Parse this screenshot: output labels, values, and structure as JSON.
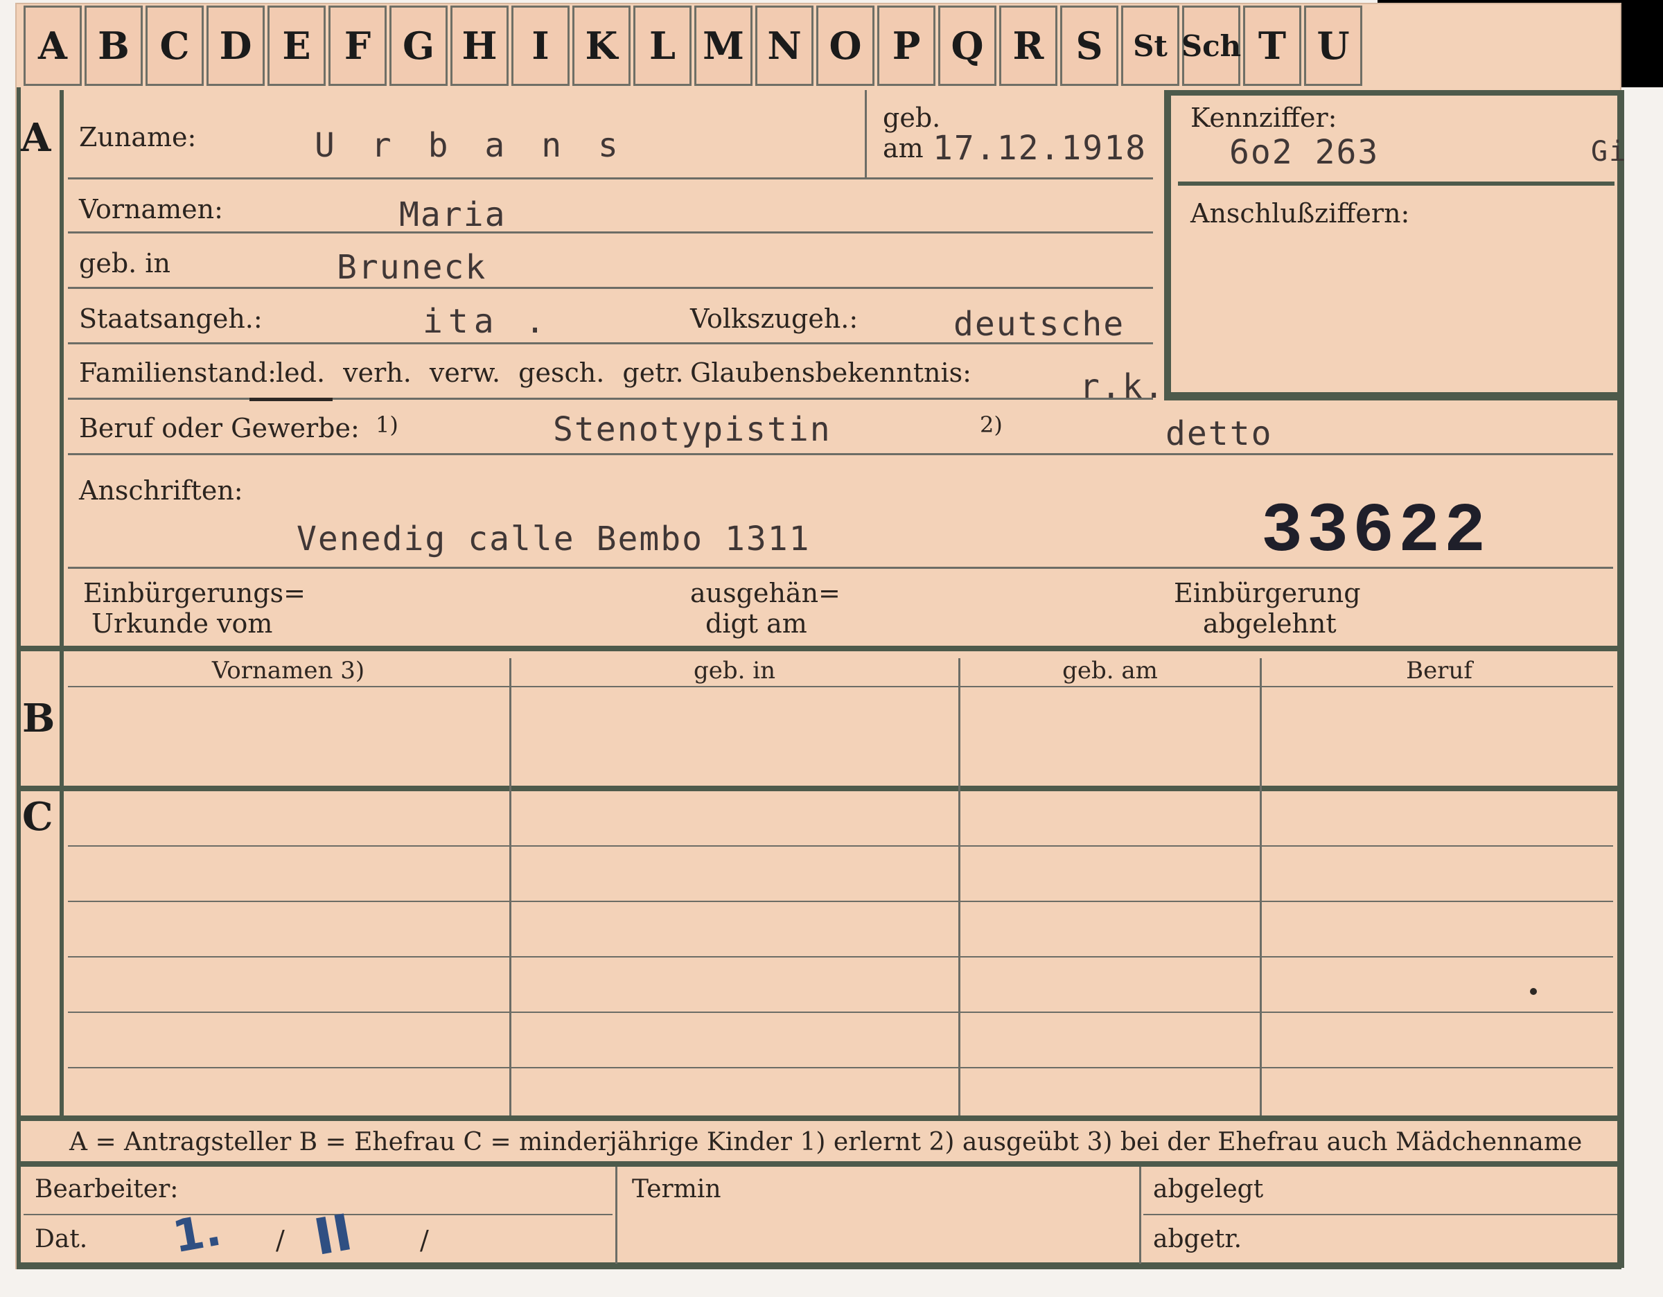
{
  "tabs": [
    "A",
    "B",
    "C",
    "D",
    "E",
    "F",
    "G",
    "H",
    "I",
    "K",
    "L",
    "M",
    "N",
    "O",
    "P",
    "Q",
    "R",
    "S",
    "St",
    "Sch",
    "T",
    "U"
  ],
  "sectionA": {
    "row_label": "A",
    "zuname_label": "Zuname:",
    "zuname_value": "U r b a n s",
    "geb_label": "geb.",
    "am_label": "am",
    "geb_date": "17.12.1918",
    "kennziffer_label": "Kennziffer:",
    "kennziffer_value": "6o2 263",
    "kennziffer_suffix": "Gi",
    "anschluss_label": "Anschlußziffern:",
    "vornamen_label": "Vornamen:",
    "vornamen_value": "Maria",
    "gebin_label": "geb. in",
    "gebin_value": "Bruneck",
    "staat_label": "Staatsangeh.:",
    "staat_value": "ita .",
    "volk_label": "Volkszugeh.:",
    "volk_value": "deutsche",
    "familien_label": "Familienstand:",
    "familien_options": "led. verh. verw. gesch. getr.",
    "glaube_label": "Glaubensbekenntnis:",
    "glaube_value": "r.k.",
    "beruf_label": "Beruf oder Gewerbe:",
    "beruf_note1": "1)",
    "beruf_value": "Stenotypistin",
    "beruf_note2": "2)",
    "beruf_value2": "detto",
    "anschriften_label": "Anschriften:",
    "anschriften_value": "Venedig calle Bembo 1311",
    "stamp_number": "33622",
    "einb_urkunde_label_1": "Einbürgerungs=",
    "einb_urkunde_label_2": "Urkunde vom",
    "ausgehaendigt_label_1": "ausgehän=",
    "ausgehaendigt_label_2": "digt am",
    "einb_abgelehnt_label_1": "Einbürgerung",
    "einb_abgelehnt_label_2": "abgelehnt"
  },
  "sectionB": {
    "row_label": "B",
    "columns": [
      "Vornamen 3)",
      "geb. in",
      "geb. am",
      "Beruf"
    ]
  },
  "sectionC": {
    "row_label": "C"
  },
  "legend": "A = Antragsteller   B = Ehefrau   C = minderjährige Kinder   1) erlernt   2) ausgeübt   3) bei der Ehefrau auch Mädchenname",
  "bottom": {
    "bearbeiter_label": "Bearbeiter:",
    "termin_label": "Termin",
    "abgelegt_label": "abgelegt",
    "dat_label": "Dat.",
    "dat_day": "1.",
    "dat_sep1": "/",
    "dat_month": "II",
    "dat_sep2": "/",
    "abgetr_label": "abgetr."
  },
  "colors": {
    "card": "#f3d2b8",
    "rule": "#4d5a4b",
    "ink_typed": "#403736",
    "pen_blue": "#2f4f82"
  }
}
